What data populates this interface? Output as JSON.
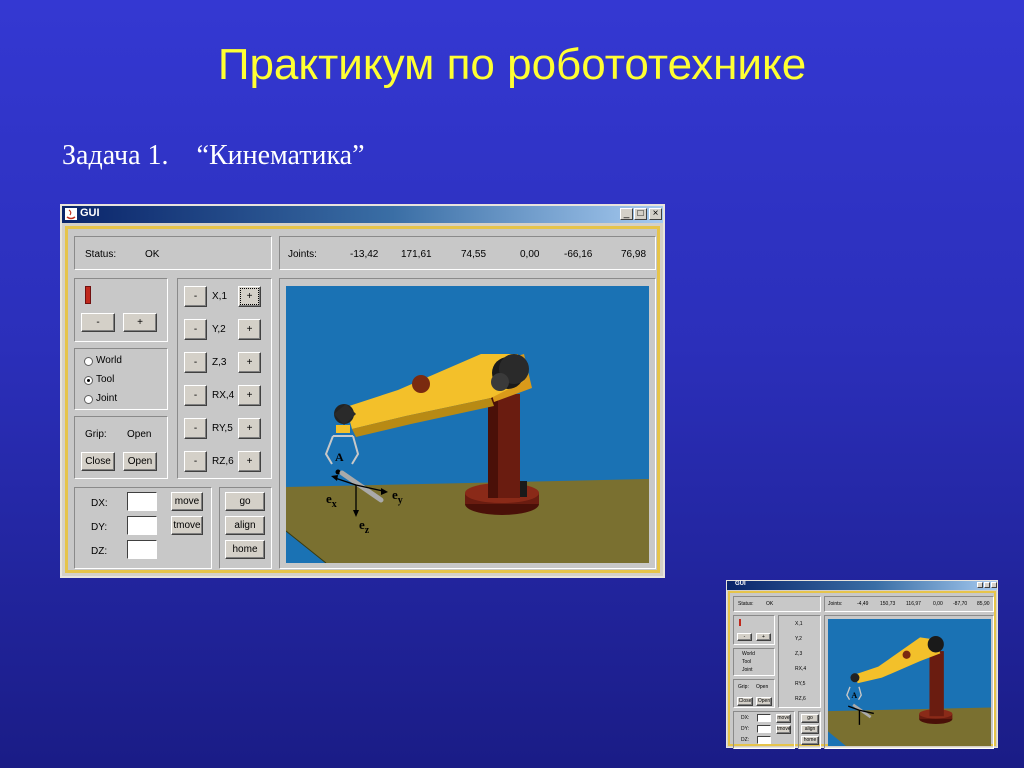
{
  "slide": {
    "title": "Практикум по робототехнике",
    "task_label": "Задача 1.",
    "task_name": "“Кинематика”"
  },
  "window": {
    "title": "GUI",
    "minimize": "_",
    "maximize": "□",
    "close": "×"
  },
  "status": {
    "label": "Status:",
    "value": "OK"
  },
  "joints": {
    "label": "Joints:",
    "values": [
      "-13,42",
      "171,61",
      "74,55",
      "0,00",
      "-66,16",
      "76,98"
    ]
  },
  "speed": {
    "minus": "-",
    "plus": "+"
  },
  "frames": {
    "options": [
      "World",
      "Tool",
      "Joint"
    ],
    "selected": "Tool"
  },
  "grip": {
    "label": "Grip:",
    "value": "Open",
    "close_btn": "Close",
    "open_btn": "Open"
  },
  "axes": [
    {
      "label": "X,1",
      "minus": "-",
      "plus": "+"
    },
    {
      "label": "Y,2",
      "minus": "-",
      "plus": "+"
    },
    {
      "label": "Z,3",
      "minus": "-",
      "plus": "+"
    },
    {
      "label": "RX,4",
      "minus": "-",
      "plus": "+"
    },
    {
      "label": "RY,5",
      "minus": "-",
      "plus": "+"
    },
    {
      "label": "RZ,6",
      "minus": "-",
      "plus": "+"
    }
  ],
  "move": {
    "dx_label": "DX:",
    "dy_label": "DY:",
    "dz_label": "DZ:",
    "dx_value": "",
    "dy_value": "",
    "dz_value": "",
    "move_btn": "move",
    "tmove_btn": "tmove"
  },
  "actions": {
    "go": "go",
    "align": "align",
    "home": "home"
  },
  "scene": {
    "point_label": "A",
    "ex": "e",
    "ex_sub": "x",
    "ey": "e",
    "ey_sub": "y",
    "ez": "e",
    "ez_sub": "z"
  },
  "thumbnail": {
    "title": "GUI",
    "status_label": "Status:",
    "status_value": "OK",
    "joints_label": "Joints:",
    "joint_values": [
      "-4,49",
      "150,73",
      "116,97",
      "0,00",
      "-87,70",
      "85,90"
    ],
    "axes": [
      "X,1",
      "Y,2",
      "Z,3",
      "RX,4",
      "RY,5",
      "RZ,6"
    ],
    "frames": [
      "World",
      "Tool",
      "Joint"
    ],
    "grip_label": "Grip:",
    "grip_value": "Open",
    "close_btn": "Close",
    "open_btn": "Open",
    "dx_label": "DX:",
    "dy_label": "DY:",
    "dz_label": "DZ:",
    "move_btn": "move",
    "tmove_btn": "tmove",
    "go": "go",
    "align": "align",
    "home": "home",
    "minus": "-",
    "plus": "+",
    "point_label": "A"
  },
  "colors": {
    "slide_bg": "#2b2fba",
    "title": "#ffff33",
    "window_face": "#d4d0c8",
    "inner_border": "#e6c44a",
    "scene_sky": "#1a72b4",
    "scene_floor": "#7a7030",
    "arm_yellow": "#f3c02a",
    "arm_base": "#6a1c10"
  }
}
